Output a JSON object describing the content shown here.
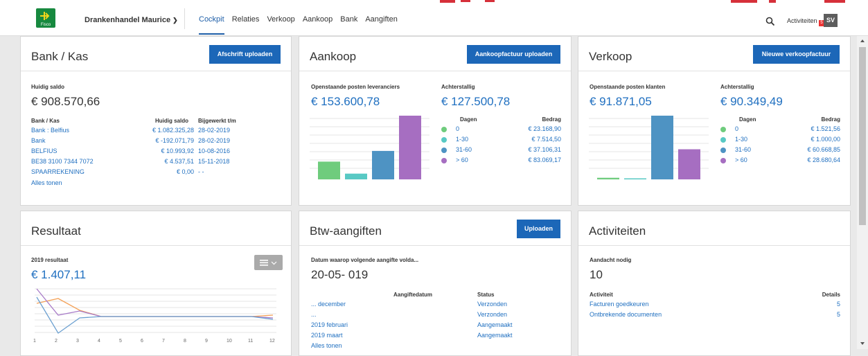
{
  "header": {
    "logo_text": "Fisco",
    "company": "Drankenhandel Maurice",
    "nav": [
      "Cockpit",
      "Relaties",
      "Verkoop",
      "Aankoop",
      "Bank",
      "Aangiften"
    ],
    "activities": "Activiteiten",
    "activities_count": "5",
    "avatar": "SV"
  },
  "bank": {
    "title": "Bank / Kas",
    "button": "Afschrift uploaden",
    "balance_label": "Huidig saldo",
    "balance": "€ 908.570,66",
    "col_bank": "Bank / Kas",
    "col_saldo": "Huidig saldo",
    "col_date": "Bijgewerkt t/m",
    "rows": [
      {
        "name": "Bank : Belfius",
        "saldo": "€ 1.082.325,28",
        "date": "28-02-2019"
      },
      {
        "name": "Bank",
        "saldo": "€ -192.071,79",
        "date": "28-02-2019"
      },
      {
        "name": "BELFIUS",
        "saldo": "€ 10.993,92",
        "date": "10-08-2016"
      },
      {
        "name": "BE38 3100 7344 7072",
        "saldo": "€ 4.537,51",
        "date": "15-11-2018"
      },
      {
        "name": "SPAARREKENING",
        "saldo": "€ 0,00",
        "date": "- -"
      }
    ],
    "show_all": "Alles tonen"
  },
  "purchase": {
    "title": "Aankoop",
    "button": "Aankoopfactuur uploaden",
    "open_label": "Openstaande posten leveranciers",
    "open_value": "€ 153.600,78",
    "overdue_label": "Achterstallig",
    "overdue_value": "€ 127.500,78",
    "col_days": "Dagen",
    "col_amount": "Bedrag",
    "rows": [
      {
        "days": "0",
        "amount": "€ 23.168,90"
      },
      {
        "days": "1-30",
        "amount": "€ 7.514,50"
      },
      {
        "days": "31-60",
        "amount": "€ 37.106,31"
      },
      {
        "days": "> 60",
        "amount": "€ 83.069,17"
      }
    ],
    "bars": [
      23168.9,
      7514.5,
      37106.31,
      83069.17
    ]
  },
  "sales": {
    "title": "Verkoop",
    "button": "Nieuwe verkoopfactuur",
    "open_label": "Openstaande posten klanten",
    "open_value": "€ 91.871,05",
    "overdue_label": "Achterstallig",
    "overdue_value": "€ 90.349,49",
    "col_days": "Dagen",
    "col_amount": "Bedrag",
    "rows": [
      {
        "days": "0",
        "amount": "€ 1.521,56"
      },
      {
        "days": "1-30",
        "amount": "€ 1.000,00"
      },
      {
        "days": "31-60",
        "amount": "€ 60.668,85"
      },
      {
        "days": "> 60",
        "amount": "€ 28.680,64"
      }
    ],
    "bars": [
      1521.56,
      1000.0,
      60668.85,
      28680.64
    ]
  },
  "result": {
    "title": "Resultaat",
    "year_label": "2019 resultaat",
    "value": "€ 1.407,11",
    "x_ticks": [
      "1",
      "2",
      "3",
      "4",
      "5",
      "6",
      "7",
      "8",
      "9",
      "10",
      "11",
      "12"
    ]
  },
  "vat": {
    "title": "Btw-aangiften",
    "button": "Uploaden",
    "next_label": "Datum waarop volgende aangifte volda...",
    "next_date": "20-05- 019",
    "col_date": "Aangiftedatum",
    "col_status": "Status",
    "rows": [
      {
        "period": "... december",
        "status": "Verzonden"
      },
      {
        "period": "...",
        "status": "Verzonden"
      },
      {
        "period": "2019 februari",
        "status": "Aangemaakt"
      },
      {
        "period": "2019 maart",
        "status": "Aangemaakt"
      }
    ],
    "show_all": "Alles tonen"
  },
  "activities": {
    "title": "Activiteiten",
    "attention_label": "Aandacht nodig",
    "attention_value": "10",
    "col_activity": "Activiteit",
    "col_details": "Details",
    "rows": [
      {
        "name": "Facturen goedkeuren",
        "count": "5"
      },
      {
        "name": "Ontbrekende documenten",
        "count": "5"
      }
    ]
  },
  "colors": {
    "green": "#6fcc7d",
    "teal": "#58c9c4",
    "blue": "#4e93c3",
    "purple": "#a66ec1",
    "accent": "#1c67b8"
  }
}
